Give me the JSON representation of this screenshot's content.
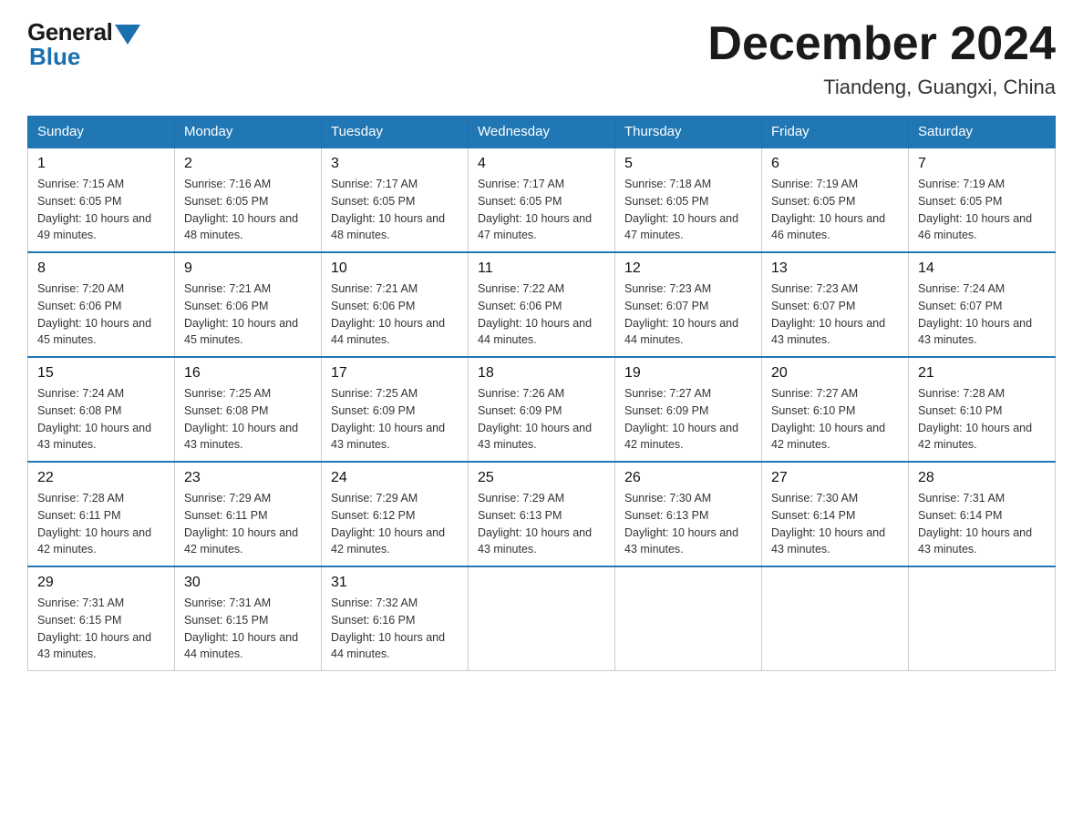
{
  "header": {
    "logo_general": "General",
    "logo_blue": "Blue",
    "month_title": "December 2024",
    "location": "Tiandeng, Guangxi, China"
  },
  "days_of_week": [
    "Sunday",
    "Monday",
    "Tuesday",
    "Wednesday",
    "Thursday",
    "Friday",
    "Saturday"
  ],
  "weeks": [
    [
      {
        "day": "1",
        "sunrise": "7:15 AM",
        "sunset": "6:05 PM",
        "daylight": "10 hours and 49 minutes."
      },
      {
        "day": "2",
        "sunrise": "7:16 AM",
        "sunset": "6:05 PM",
        "daylight": "10 hours and 48 minutes."
      },
      {
        "day": "3",
        "sunrise": "7:17 AM",
        "sunset": "6:05 PM",
        "daylight": "10 hours and 48 minutes."
      },
      {
        "day": "4",
        "sunrise": "7:17 AM",
        "sunset": "6:05 PM",
        "daylight": "10 hours and 47 minutes."
      },
      {
        "day": "5",
        "sunrise": "7:18 AM",
        "sunset": "6:05 PM",
        "daylight": "10 hours and 47 minutes."
      },
      {
        "day": "6",
        "sunrise": "7:19 AM",
        "sunset": "6:05 PM",
        "daylight": "10 hours and 46 minutes."
      },
      {
        "day": "7",
        "sunrise": "7:19 AM",
        "sunset": "6:05 PM",
        "daylight": "10 hours and 46 minutes."
      }
    ],
    [
      {
        "day": "8",
        "sunrise": "7:20 AM",
        "sunset": "6:06 PM",
        "daylight": "10 hours and 45 minutes."
      },
      {
        "day": "9",
        "sunrise": "7:21 AM",
        "sunset": "6:06 PM",
        "daylight": "10 hours and 45 minutes."
      },
      {
        "day": "10",
        "sunrise": "7:21 AM",
        "sunset": "6:06 PM",
        "daylight": "10 hours and 44 minutes."
      },
      {
        "day": "11",
        "sunrise": "7:22 AM",
        "sunset": "6:06 PM",
        "daylight": "10 hours and 44 minutes."
      },
      {
        "day": "12",
        "sunrise": "7:23 AM",
        "sunset": "6:07 PM",
        "daylight": "10 hours and 44 minutes."
      },
      {
        "day": "13",
        "sunrise": "7:23 AM",
        "sunset": "6:07 PM",
        "daylight": "10 hours and 43 minutes."
      },
      {
        "day": "14",
        "sunrise": "7:24 AM",
        "sunset": "6:07 PM",
        "daylight": "10 hours and 43 minutes."
      }
    ],
    [
      {
        "day": "15",
        "sunrise": "7:24 AM",
        "sunset": "6:08 PM",
        "daylight": "10 hours and 43 minutes."
      },
      {
        "day": "16",
        "sunrise": "7:25 AM",
        "sunset": "6:08 PM",
        "daylight": "10 hours and 43 minutes."
      },
      {
        "day": "17",
        "sunrise": "7:25 AM",
        "sunset": "6:09 PM",
        "daylight": "10 hours and 43 minutes."
      },
      {
        "day": "18",
        "sunrise": "7:26 AM",
        "sunset": "6:09 PM",
        "daylight": "10 hours and 43 minutes."
      },
      {
        "day": "19",
        "sunrise": "7:27 AM",
        "sunset": "6:09 PM",
        "daylight": "10 hours and 42 minutes."
      },
      {
        "day": "20",
        "sunrise": "7:27 AM",
        "sunset": "6:10 PM",
        "daylight": "10 hours and 42 minutes."
      },
      {
        "day": "21",
        "sunrise": "7:28 AM",
        "sunset": "6:10 PM",
        "daylight": "10 hours and 42 minutes."
      }
    ],
    [
      {
        "day": "22",
        "sunrise": "7:28 AM",
        "sunset": "6:11 PM",
        "daylight": "10 hours and 42 minutes."
      },
      {
        "day": "23",
        "sunrise": "7:29 AM",
        "sunset": "6:11 PM",
        "daylight": "10 hours and 42 minutes."
      },
      {
        "day": "24",
        "sunrise": "7:29 AM",
        "sunset": "6:12 PM",
        "daylight": "10 hours and 42 minutes."
      },
      {
        "day": "25",
        "sunrise": "7:29 AM",
        "sunset": "6:13 PM",
        "daylight": "10 hours and 43 minutes."
      },
      {
        "day": "26",
        "sunrise": "7:30 AM",
        "sunset": "6:13 PM",
        "daylight": "10 hours and 43 minutes."
      },
      {
        "day": "27",
        "sunrise": "7:30 AM",
        "sunset": "6:14 PM",
        "daylight": "10 hours and 43 minutes."
      },
      {
        "day": "28",
        "sunrise": "7:31 AM",
        "sunset": "6:14 PM",
        "daylight": "10 hours and 43 minutes."
      }
    ],
    [
      {
        "day": "29",
        "sunrise": "7:31 AM",
        "sunset": "6:15 PM",
        "daylight": "10 hours and 43 minutes."
      },
      {
        "day": "30",
        "sunrise": "7:31 AM",
        "sunset": "6:15 PM",
        "daylight": "10 hours and 44 minutes."
      },
      {
        "day": "31",
        "sunrise": "7:32 AM",
        "sunset": "6:16 PM",
        "daylight": "10 hours and 44 minutes."
      },
      null,
      null,
      null,
      null
    ]
  ]
}
